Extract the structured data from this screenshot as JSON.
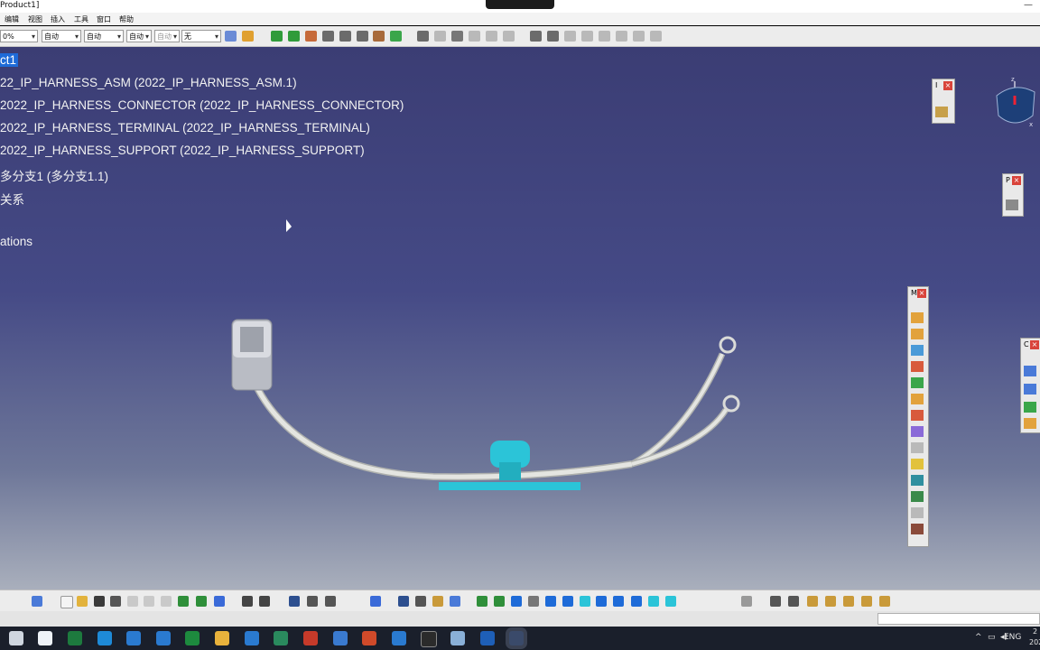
{
  "window": {
    "title": "Product1]",
    "minimize": "—"
  },
  "menu": [
    "编辑",
    "视图",
    "插入",
    "工具",
    "窗口",
    "帮助"
  ],
  "toolbar": {
    "combos": [
      {
        "value": "0%"
      },
      {
        "value": "自动"
      },
      {
        "value": "自动"
      },
      {
        "value": "自动"
      },
      {
        "value": "自动"
      },
      {
        "value": "无"
      }
    ]
  },
  "tree": {
    "root": "ct1",
    "items": [
      "22_IP_HARNESS_ASM (2022_IP_HARNESS_ASM.1)",
      "2022_IP_HARNESS_CONNECTOR (2022_IP_HARNESS_CONNECTOR)",
      "2022_IP_HARNESS_TERMINAL (2022_IP_HARNESS_TERMINAL)",
      "2022_IP_HARNESS_SUPPORT (2022_IP_HARNESS_SUPPORT)",
      "多分支1 (多分支1.1)",
      "关系",
      "",
      "ations"
    ]
  },
  "compass": {
    "z": "z",
    "x": "x"
  },
  "panels": {
    "top_left_label": "I",
    "mid_label": "P",
    "long_label": "M",
    "right_label": "C"
  },
  "colors": {
    "accent": "#1e6bd8",
    "wire": "#d8d9d5",
    "support": "#2bc4d8",
    "connector": "#cfd2d8",
    "panel_close": "#d9443b"
  },
  "taskbar": {
    "lang": "ENG",
    "clock_line1": "2",
    "clock_line2": "202"
  }
}
